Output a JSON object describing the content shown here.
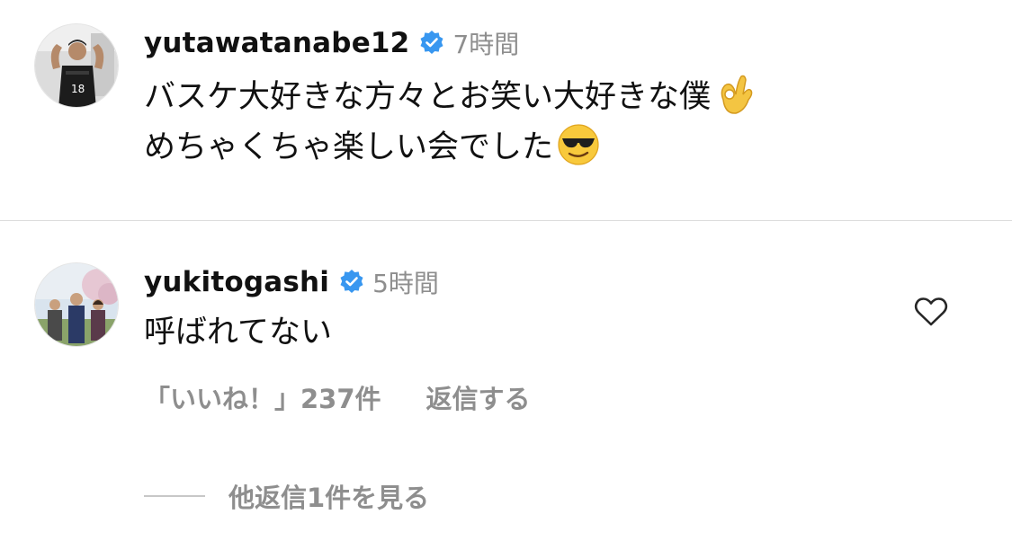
{
  "comments": [
    {
      "username": "yutawatanabe12",
      "verified": true,
      "time": "7時間",
      "lines": [
        "バスケ大好きな方々とお笑い大好きな僕",
        "めちゃくちゃ楽しい会でした"
      ],
      "emojis": [
        "ok-hand-emoji",
        "sunglasses-face-emoji"
      ]
    },
    {
      "username": "yukitogashi",
      "verified": true,
      "time": "5時間",
      "lines": [
        "呼ばれてない"
      ],
      "likes": "「いいね！」237件",
      "reply": "返信する",
      "view_replies": "他返信1件を見る"
    }
  ],
  "colors": {
    "text": "#111111",
    "secondary": "#8e8e8e",
    "verified": "#3897f0",
    "divider": "#dbdbdb"
  }
}
